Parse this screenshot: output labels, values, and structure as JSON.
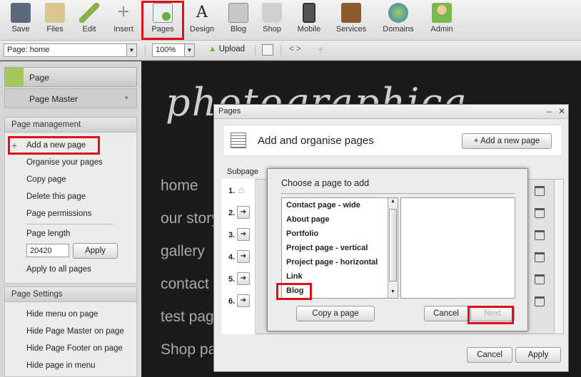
{
  "toolbar": {
    "buttons": [
      {
        "label": "Save",
        "icon": "floppy-disk-icon"
      },
      {
        "label": "Files",
        "icon": "folder-icon"
      },
      {
        "label": "Edit",
        "icon": "pencil-icon"
      },
      {
        "label": "Insert",
        "icon": "plus-icon"
      },
      {
        "label": "Pages",
        "icon": "pages-icon"
      },
      {
        "label": "Design",
        "icon": "design-icon"
      },
      {
        "label": "Blog",
        "icon": "blog-icon"
      },
      {
        "label": "Shop",
        "icon": "basket-icon"
      },
      {
        "label": "Mobile",
        "icon": "phone-icon"
      },
      {
        "label": "Services",
        "icon": "briefcase-icon"
      },
      {
        "label": "Domains",
        "icon": "globe-icon"
      },
      {
        "label": "Admin",
        "icon": "user-icon"
      }
    ]
  },
  "subbar": {
    "page_select": "Page: home",
    "zoom": "100%",
    "upload": "Upload",
    "code": "< >",
    "plus": "+"
  },
  "sidebar": {
    "tab_page": "Page",
    "tab_page_master": "Page Master",
    "page_management": "Page management",
    "links": [
      "Add a new page",
      "Organise your pages",
      "Copy page",
      "Delete this page",
      "Page permissions"
    ],
    "page_length_label": "Page length",
    "page_length_value": "20420",
    "apply": "Apply",
    "apply_all": "Apply to all pages",
    "page_settings": "Page Settings",
    "settings_links": [
      "Hide menu on page",
      "Hide Page Master on page",
      "Hide Page Footer on page",
      "Hide page in menu"
    ]
  },
  "canvas": {
    "logo": "photographica",
    "nav": [
      "home",
      "our story",
      "gallery",
      "contact",
      "test page",
      "Shop pa"
    ]
  },
  "pages_dialog": {
    "title": "Pages",
    "header": "Add and organise pages",
    "add_button": "Add a new page",
    "subpage_label": "Subpage",
    "row_numbers": [
      "1.",
      "2.",
      "3.",
      "4.",
      "5.",
      "6."
    ],
    "cancel": "Cancel",
    "apply": "Apply"
  },
  "choose_dialog": {
    "title": "Choose a page to add",
    "items": [
      "Contact page - wide",
      "About page",
      "Portfolio",
      "Project page - vertical",
      "Project page - horizontal",
      "Link",
      "Blog"
    ],
    "copy_button": "Copy a page",
    "cancel": "Cancel",
    "next": "Next"
  },
  "colors": {
    "highlight": "#e0101a",
    "accent_green": "#a4c65a"
  }
}
